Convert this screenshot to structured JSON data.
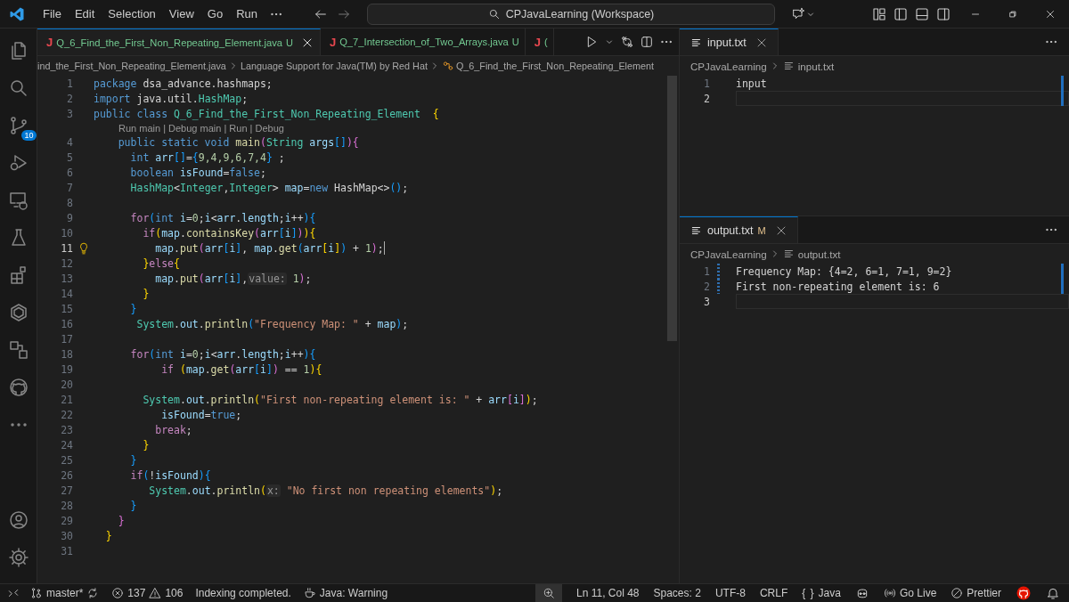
{
  "title_bar": {
    "menu": [
      "File",
      "Edit",
      "Selection",
      "View",
      "Go",
      "Run"
    ],
    "command_center": "CPJavaLearning (Workspace)"
  },
  "activity_bar": {
    "source_control_badge": "10"
  },
  "editor": {
    "tabs": [
      {
        "icon": "J",
        "label": "Q_6_Find_the_First_Non_Repeating_Element.java",
        "status": "U",
        "selected": true
      },
      {
        "icon": "J",
        "label": "Q_7_Intersection_of_Two_Arrays.java",
        "status": "U",
        "selected": false
      },
      {
        "icon": "J",
        "label": "(",
        "selected": false
      }
    ],
    "breadcrumb": [
      "ind_the_First_Non_Repeating_Element.java",
      "Language Support for Java(TM) by Red Hat",
      "Q_6_Find_the_First_Non_Repeating_Element"
    ],
    "lines": [
      {
        "number": "1",
        "current": false,
        "tokens": [
          {
            "kind": "kw",
            "text": "package"
          },
          {
            "kind": "p",
            "text": " dsa_advance.hashmaps;"
          }
        ]
      },
      {
        "number": "2",
        "current": false,
        "tokens": [
          {
            "kind": "kw",
            "text": "import"
          },
          {
            "kind": "p",
            "text": " java.util."
          },
          {
            "kind": "type",
            "text": "HashMap"
          },
          {
            "kind": "p",
            "text": ";"
          }
        ]
      },
      {
        "number": "3",
        "current": false,
        "tokens": [
          {
            "kind": "kw",
            "text": "public class"
          },
          {
            "kind": "type",
            "text": " Q_6_Find_the_First_Non_Repeating_Element"
          },
          {
            "kind": "b1",
            "text": "  {"
          }
        ]
      },
      {
        "number": "4",
        "current": false,
        "codelens": "Run main | Debug main | Run | Debug",
        "tokens": [
          {
            "kind": "kw",
            "text": "    public static void"
          },
          {
            "kind": "fn",
            "text": " main"
          },
          {
            "kind": "b2",
            "text": "("
          },
          {
            "kind": "type",
            "text": "String"
          },
          {
            "kind": "var",
            "text": " args"
          },
          {
            "kind": "b3",
            "text": "[]"
          },
          {
            "kind": "b2",
            "text": "){"
          }
        ]
      },
      {
        "number": "5",
        "current": false,
        "tokens": [
          {
            "kind": "kw",
            "text": "      int"
          },
          {
            "kind": "var",
            "text": " arr"
          },
          {
            "kind": "b3",
            "text": "[]"
          },
          {
            "kind": "p",
            "text": "="
          },
          {
            "kind": "b3",
            "text": "{"
          },
          {
            "kind": "num",
            "text": "9,4,9,6,7,4"
          },
          {
            "kind": "b3",
            "text": "}"
          },
          {
            "kind": "p",
            "text": " ;"
          }
        ]
      },
      {
        "number": "6",
        "current": false,
        "tokens": [
          {
            "kind": "kw",
            "text": "      boolean"
          },
          {
            "kind": "var",
            "text": " isFound"
          },
          {
            "kind": "p",
            "text": "="
          },
          {
            "kind": "kw",
            "text": "false"
          },
          {
            "kind": "p",
            "text": ";"
          }
        ]
      },
      {
        "number": "7",
        "current": false,
        "tokens": [
          {
            "kind": "type",
            "text": "      HashMap"
          },
          {
            "kind": "p",
            "text": "<"
          },
          {
            "kind": "type",
            "text": "Integer"
          },
          {
            "kind": "p",
            "text": ","
          },
          {
            "kind": "type",
            "text": "Integer"
          },
          {
            "kind": "p",
            "text": ">"
          },
          {
            "kind": "var",
            "text": " map"
          },
          {
            "kind": "p",
            "text": "="
          },
          {
            "kind": "kw",
            "text": "new"
          },
          {
            "kind": "p",
            "text": " HashMap<>"
          },
          {
            "kind": "b3",
            "text": "()"
          },
          {
            "kind": "p",
            "text": ";"
          }
        ]
      },
      {
        "number": "8",
        "current": false
      },
      {
        "number": "9",
        "current": false,
        "tokens": [
          {
            "kind": "ctl",
            "text": "      for"
          },
          {
            "kind": "b3",
            "text": "("
          },
          {
            "kind": "kw",
            "text": "int"
          },
          {
            "kind": "var",
            "text": " i"
          },
          {
            "kind": "p",
            "text": "="
          },
          {
            "kind": "num",
            "text": "0"
          },
          {
            "kind": "p",
            "text": ";"
          },
          {
            "kind": "var",
            "text": "i"
          },
          {
            "kind": "p",
            "text": "<"
          },
          {
            "kind": "var",
            "text": "arr"
          },
          {
            "kind": "p",
            "text": "."
          },
          {
            "kind": "var",
            "text": "length"
          },
          {
            "kind": "p",
            "text": ";"
          },
          {
            "kind": "var",
            "text": "i"
          },
          {
            "kind": "p",
            "text": "++"
          },
          {
            "kind": "b3",
            "text": "){"
          }
        ]
      },
      {
        "number": "10",
        "current": false,
        "tokens": [
          {
            "kind": "ctl",
            "text": "        if"
          },
          {
            "kind": "b1",
            "text": "("
          },
          {
            "kind": "var",
            "text": "map"
          },
          {
            "kind": "p",
            "text": "."
          },
          {
            "kind": "fn",
            "text": "containsKey"
          },
          {
            "kind": "b2",
            "text": "("
          },
          {
            "kind": "var",
            "text": "arr"
          },
          {
            "kind": "b3",
            "text": "["
          },
          {
            "kind": "var",
            "text": "i"
          },
          {
            "kind": "b3",
            "text": "]"
          },
          {
            "kind": "b2",
            "text": ")"
          },
          {
            "kind": "b1",
            "text": "){"
          }
        ]
      },
      {
        "number": "11",
        "current": true,
        "lightbulb": true,
        "tokens": [
          {
            "kind": "var",
            "text": "          map"
          },
          {
            "kind": "p",
            "text": "."
          },
          {
            "kind": "fn",
            "text": "put"
          },
          {
            "kind": "b2",
            "text": "("
          },
          {
            "kind": "var",
            "text": "arr"
          },
          {
            "kind": "b3",
            "text": "["
          },
          {
            "kind": "var",
            "text": "i"
          },
          {
            "kind": "b3",
            "text": "]"
          },
          {
            "kind": "p",
            "text": ","
          },
          {
            "kind": "var",
            "text": " map"
          },
          {
            "kind": "p",
            "text": "."
          },
          {
            "kind": "fn",
            "text": "get"
          },
          {
            "kind": "b3",
            "text": "("
          },
          {
            "kind": "var",
            "text": "arr"
          },
          {
            "kind": "b1",
            "text": "["
          },
          {
            "kind": "var",
            "text": "i"
          },
          {
            "kind": "b1",
            "text": "]"
          },
          {
            "kind": "b3",
            "text": ")"
          },
          {
            "kind": "p",
            "text": " + "
          },
          {
            "kind": "num",
            "text": "1"
          },
          {
            "kind": "b2",
            "text": ")"
          },
          {
            "kind": "p",
            "text": ";"
          }
        ]
      },
      {
        "number": "12",
        "current": false,
        "tokens": [
          {
            "kind": "b1",
            "text": "        }"
          },
          {
            "kind": "ctl",
            "text": "else"
          },
          {
            "kind": "b1",
            "text": "{"
          }
        ]
      },
      {
        "number": "13",
        "current": false,
        "tokens": [
          {
            "kind": "var",
            "text": "          map"
          },
          {
            "kind": "p",
            "text": "."
          },
          {
            "kind": "fn",
            "text": "put"
          },
          {
            "kind": "b2",
            "text": "("
          },
          {
            "kind": "var",
            "text": "arr"
          },
          {
            "kind": "b3",
            "text": "["
          },
          {
            "kind": "var",
            "text": "i"
          },
          {
            "kind": "b3",
            "text": "]"
          },
          {
            "kind": "p",
            "text": ","
          },
          {
            "kind": "hint",
            "text": "value:"
          },
          {
            "kind": "num",
            "text": " 1"
          },
          {
            "kind": "b2",
            "text": ")"
          },
          {
            "kind": "p",
            "text": ";"
          }
        ]
      },
      {
        "number": "14",
        "current": false,
        "tokens": [
          {
            "kind": "b1",
            "text": "        }"
          }
        ]
      },
      {
        "number": "15",
        "current": false,
        "tokens": [
          {
            "kind": "b3",
            "text": "      }"
          }
        ]
      },
      {
        "number": "16",
        "current": false,
        "tokens": [
          {
            "kind": "type",
            "text": "       System"
          },
          {
            "kind": "p",
            "text": "."
          },
          {
            "kind": "var",
            "text": "out"
          },
          {
            "kind": "p",
            "text": "."
          },
          {
            "kind": "fn",
            "text": "println"
          },
          {
            "kind": "b3",
            "text": "("
          },
          {
            "kind": "str",
            "text": "\"Frequency Map: \""
          },
          {
            "kind": "p",
            "text": " + "
          },
          {
            "kind": "var",
            "text": "map"
          },
          {
            "kind": "b3",
            "text": ")"
          },
          {
            "kind": "p",
            "text": ";"
          }
        ]
      },
      {
        "number": "17",
        "current": false
      },
      {
        "number": "18",
        "current": false,
        "tokens": [
          {
            "kind": "ctl",
            "text": "      for"
          },
          {
            "kind": "b3",
            "text": "("
          },
          {
            "kind": "kw",
            "text": "int"
          },
          {
            "kind": "var",
            "text": " i"
          },
          {
            "kind": "p",
            "text": "="
          },
          {
            "kind": "num",
            "text": "0"
          },
          {
            "kind": "p",
            "text": ";"
          },
          {
            "kind": "var",
            "text": "i"
          },
          {
            "kind": "p",
            "text": "<"
          },
          {
            "kind": "var",
            "text": "arr"
          },
          {
            "kind": "p",
            "text": "."
          },
          {
            "kind": "var",
            "text": "length"
          },
          {
            "kind": "p",
            "text": ";"
          },
          {
            "kind": "var",
            "text": "i"
          },
          {
            "kind": "p",
            "text": "++"
          },
          {
            "kind": "b3",
            "text": "){"
          }
        ]
      },
      {
        "number": "19",
        "current": false,
        "tokens": [
          {
            "kind": "ctl",
            "text": "           if"
          },
          {
            "kind": "b1",
            "text": " ("
          },
          {
            "kind": "var",
            "text": "map"
          },
          {
            "kind": "p",
            "text": "."
          },
          {
            "kind": "fn",
            "text": "get"
          },
          {
            "kind": "b2",
            "text": "("
          },
          {
            "kind": "var",
            "text": "arr"
          },
          {
            "kind": "b3",
            "text": "["
          },
          {
            "kind": "var",
            "text": "i"
          },
          {
            "kind": "b3",
            "text": "]"
          },
          {
            "kind": "b2",
            "text": ")"
          },
          {
            "kind": "p",
            "text": " == "
          },
          {
            "kind": "num",
            "text": "1"
          },
          {
            "kind": "b1",
            "text": "){"
          }
        ]
      },
      {
        "number": "20",
        "current": false
      },
      {
        "number": "21",
        "current": false,
        "tokens": [
          {
            "kind": "type",
            "text": "        System"
          },
          {
            "kind": "p",
            "text": "."
          },
          {
            "kind": "var",
            "text": "out"
          },
          {
            "kind": "p",
            "text": "."
          },
          {
            "kind": "fn",
            "text": "println"
          },
          {
            "kind": "b1",
            "text": "("
          },
          {
            "kind": "str",
            "text": "\"First non-repeating element is: \""
          },
          {
            "kind": "p",
            "text": " + "
          },
          {
            "kind": "var",
            "text": "arr"
          },
          {
            "kind": "b2",
            "text": "["
          },
          {
            "kind": "var",
            "text": "i"
          },
          {
            "kind": "b2",
            "text": "]"
          },
          {
            "kind": "b1",
            "text": ")"
          },
          {
            "kind": "p",
            "text": ";"
          }
        ]
      },
      {
        "number": "22",
        "current": false,
        "tokens": [
          {
            "kind": "var",
            "text": "           isFound"
          },
          {
            "kind": "p",
            "text": "="
          },
          {
            "kind": "kw",
            "text": "true"
          },
          {
            "kind": "p",
            "text": ";"
          }
        ]
      },
      {
        "number": "23",
        "current": false,
        "tokens": [
          {
            "kind": "ctl",
            "text": "          break"
          },
          {
            "kind": "p",
            "text": ";"
          }
        ]
      },
      {
        "number": "24",
        "current": false,
        "tokens": [
          {
            "kind": "b1",
            "text": "        }"
          }
        ]
      },
      {
        "number": "25",
        "current": false,
        "tokens": [
          {
            "kind": "b3",
            "text": "      }"
          }
        ]
      },
      {
        "number": "26",
        "current": false,
        "tokens": [
          {
            "kind": "ctl",
            "text": "      if"
          },
          {
            "kind": "b3",
            "text": "("
          },
          {
            "kind": "p",
            "text": "!"
          },
          {
            "kind": "var",
            "text": "isFound"
          },
          {
            "kind": "b3",
            "text": "){"
          }
        ]
      },
      {
        "number": "27",
        "current": false,
        "tokens": [
          {
            "kind": "type",
            "text": "         System"
          },
          {
            "kind": "p",
            "text": "."
          },
          {
            "kind": "var",
            "text": "out"
          },
          {
            "kind": "p",
            "text": "."
          },
          {
            "kind": "fn",
            "text": "println"
          },
          {
            "kind": "b1",
            "text": "("
          },
          {
            "kind": "hint",
            "text": "x:"
          },
          {
            "kind": "str",
            "text": " \"No first non repeating elements\""
          },
          {
            "kind": "b1",
            "text": ")"
          },
          {
            "kind": "p",
            "text": ";"
          }
        ]
      },
      {
        "number": "28",
        "current": false,
        "tokens": [
          {
            "kind": "b3",
            "text": "      }"
          }
        ]
      },
      {
        "number": "29",
        "current": false,
        "tokens": [
          {
            "kind": "b2",
            "text": "    }"
          }
        ]
      },
      {
        "number": "30",
        "current": false,
        "tokens": [
          {
            "kind": "b1",
            "text": "  }"
          }
        ]
      },
      {
        "number": "31",
        "current": false
      }
    ]
  },
  "input_pane": {
    "tab": {
      "label": "input.txt"
    },
    "breadcrumb": [
      "CPJavaLearning",
      "input.txt"
    ],
    "lines": [
      {
        "number": "1",
        "text": "input",
        "current": false
      },
      {
        "number": "2",
        "current": true
      }
    ]
  },
  "output_pane": {
    "tab": {
      "label": "output.txt",
      "status": "M"
    },
    "breadcrumb": [
      "CPJavaLearning",
      "output.txt"
    ],
    "lines": [
      {
        "number": "1",
        "text": "Frequency Map: {4=2, 6=1, 7=1, 9=2}",
        "current": false,
        "modified": true
      },
      {
        "number": "2",
        "text": "First non-repeating element is: 6",
        "current": false,
        "modified": true
      },
      {
        "number": "3",
        "current": true,
        "modified": false
      }
    ]
  },
  "status_bar": {
    "branch": "master*",
    "errors": "137",
    "warnings": "106",
    "message": "Indexing completed.",
    "java_status": "Java: Warning",
    "cursor": "Ln 11, Col 48",
    "indent": "Spaces: 2",
    "encoding": "UTF-8",
    "eol": "CRLF",
    "language_icon": "{ }",
    "language": "Java",
    "live": "Go Live",
    "formatter": "Prettier"
  }
}
